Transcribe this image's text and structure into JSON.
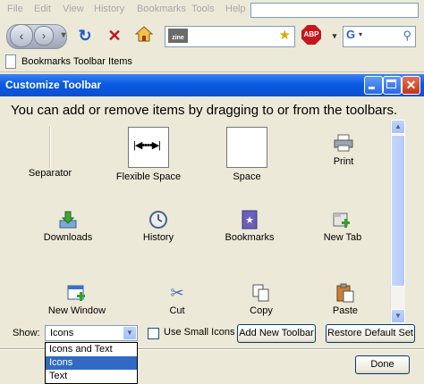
{
  "menubar": {
    "items": [
      "File",
      "Edit",
      "View",
      "History",
      "Bookmarks",
      "Tools",
      "Help"
    ]
  },
  "navbar": {
    "back_icon": "back-arrow",
    "forward_icon": "forward-arrow",
    "reload_icon": "reload",
    "stop_icon": "stop-x",
    "home_icon": "home",
    "url_site_icon": "zine",
    "bookmark_star_icon": "star",
    "adblock_label": "ABP",
    "search_engine_icon": "google-g",
    "search_icon": "magnifier"
  },
  "bookmarks_toolbar": {
    "label": "Bookmarks Toolbar Items"
  },
  "dialog": {
    "title": "Customize Toolbar",
    "instructions": "You can add or remove items by dragging to or from the toolbars.",
    "palette": [
      {
        "label": "Separator",
        "icon": "separator-icon"
      },
      {
        "label": "Flexible Space",
        "icon": "flexible-space-icon"
      },
      {
        "label": "Space",
        "icon": "space-icon"
      },
      {
        "label": "Print",
        "icon": "printer-icon"
      },
      {
        "label": "Downloads",
        "icon": "downloads-icon"
      },
      {
        "label": "History",
        "icon": "clock-icon"
      },
      {
        "label": "Bookmarks",
        "icon": "bookmarks-icon"
      },
      {
        "label": "New Tab",
        "icon": "new-tab-icon"
      },
      {
        "label": "New Window",
        "icon": "new-window-icon"
      },
      {
        "label": "Cut",
        "icon": "scissors-icon"
      },
      {
        "label": "Copy",
        "icon": "copy-icon"
      },
      {
        "label": "Paste",
        "icon": "paste-icon"
      }
    ],
    "show_label": "Show:",
    "show_value": "Icons",
    "show_options": [
      "Icons and Text",
      "Icons",
      "Text"
    ],
    "small_icons_label": "Use Small Icons",
    "small_icons_checked": false,
    "add_toolbar_label": "Add New Toolbar",
    "restore_label": "Restore Default Set",
    "done_label": "Done"
  },
  "colors": {
    "titlebar": "#0a5ae0",
    "window_bg": "#ece9d8",
    "selection": "#316ac5"
  }
}
